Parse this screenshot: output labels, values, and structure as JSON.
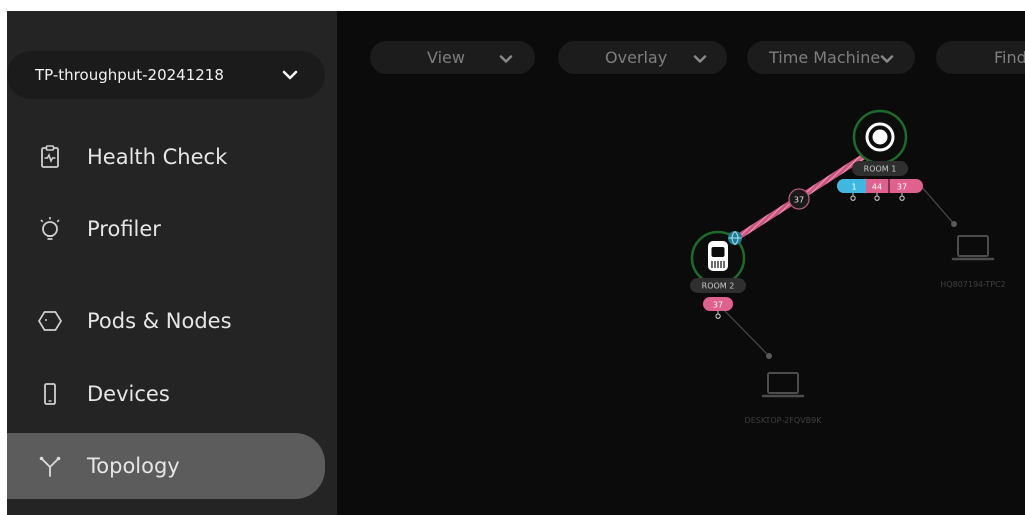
{
  "network_selector": {
    "label": "TP-throughput-20241218"
  },
  "nav": [
    {
      "label": "Health Check",
      "icon": "clipboard-pulse-icon"
    },
    {
      "label": "Profiler",
      "icon": "lightbulb-icon"
    },
    {
      "label": "Pods & Nodes",
      "icon": "hexagon-icon"
    },
    {
      "label": "Devices",
      "icon": "phone-icon"
    },
    {
      "label": "Topology",
      "icon": "topology-icon",
      "active": true
    }
  ],
  "toolbar": {
    "view": "View",
    "overlay": "Overlay",
    "time_machine": "Time Machine",
    "find": "Find"
  },
  "topology": {
    "room1": {
      "label": "ROOM 1",
      "badges": [
        "1",
        "44",
        "37"
      ]
    },
    "room2": {
      "label": "ROOM 2",
      "badges": [
        "37"
      ]
    },
    "link_label": "37",
    "devices": [
      {
        "label": "HQ807194-TPC2"
      },
      {
        "label": "DESKTOP-2FQVB9K"
      }
    ]
  },
  "colors": {
    "accent_pink": "#e0608e",
    "accent_blue": "#40b7e0",
    "node_ring_green": "#1d6b2a",
    "active_nav": "#5c5c5c"
  }
}
